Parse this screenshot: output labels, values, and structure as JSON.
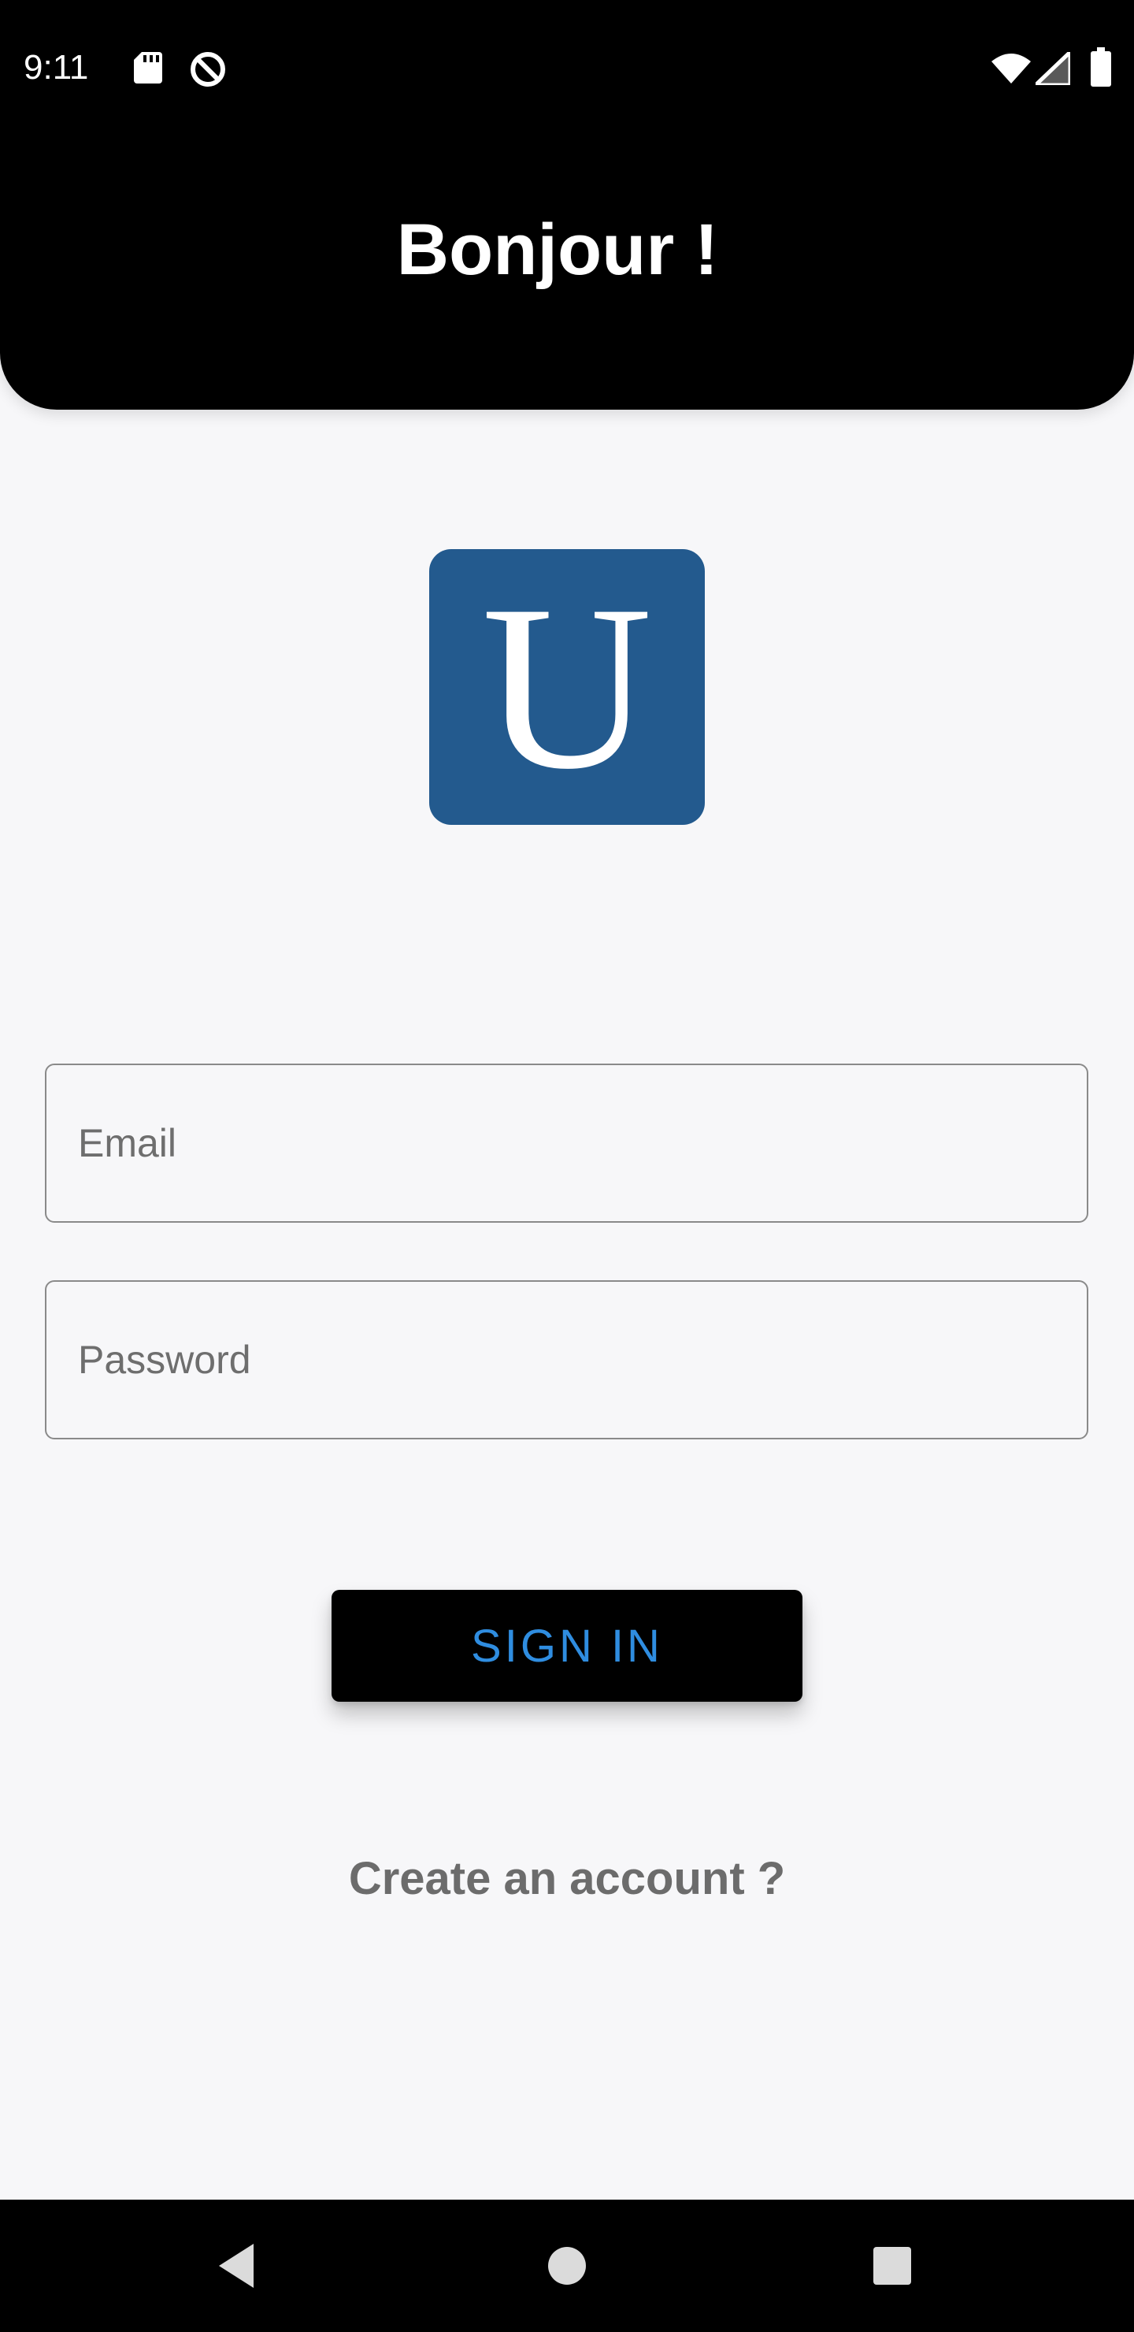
{
  "status_bar": {
    "time": "9:11",
    "left_icons": [
      "sd-card-icon",
      "data-saver-icon"
    ],
    "right_icons": [
      "wifi-icon",
      "signal-icon",
      "battery-icon"
    ]
  },
  "header": {
    "title": "Bonjour !"
  },
  "logo": {
    "letter": "U",
    "color": "#235a8e"
  },
  "form": {
    "email_placeholder": "Email",
    "password_placeholder": "Password",
    "email_value": "",
    "password_value": ""
  },
  "actions": {
    "sign_in_label": "SIGN IN",
    "sign_in_text_color": "#2f8de0",
    "create_account_label": "Create an account ?"
  },
  "nav_bar": {
    "buttons": [
      "back-icon",
      "home-icon",
      "recents-icon"
    ]
  }
}
